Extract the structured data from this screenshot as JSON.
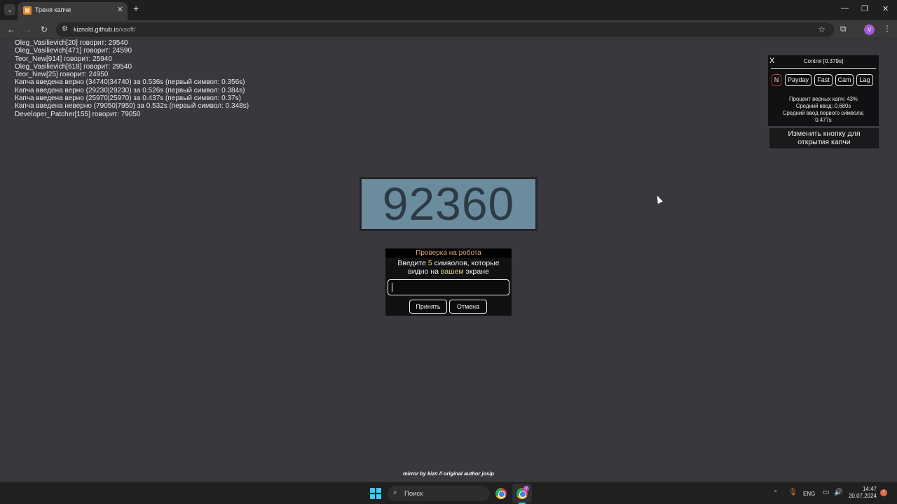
{
  "browser": {
    "tab_title": "Треня капчи",
    "url_host": "kiznold.github.io",
    "url_path": "/xsoft/",
    "icons": {
      "tab_search": "chevron-down-icon",
      "new_tab": "plus-icon",
      "back": "arrow-left-icon",
      "forward": "arrow-right-icon",
      "reload": "reload-icon",
      "bookmark": "star-icon",
      "extensions": "puzzle-icon",
      "menu": "more-vertical-icon"
    },
    "profile_letter": "V",
    "window_controls": {
      "minimize": "—",
      "maximize": "❐",
      "close": "✕"
    }
  },
  "log": [
    "Oleg_Vasilievich[20] говорит: 29540",
    "Oleg_Vasilievich[471] говорит: 24590",
    "Teor_New[914] говорит: 25940",
    "Oleg_Vasilievich[618] говорит: 29540",
    "Teor_New[25] говорит: 24950",
    "Капча введена верно (34740|34740) за 0.536s (первый символ: 0.356s)",
    "Капча введена верно (29230|29230) за 0.526s (первый символ: 0.384s)",
    "Капча введена верно (25970|25970) за 0.437s (первый символ: 0.37s)",
    "Капча введена неверно (79050|7950) за 0.532s (первый символ: 0.348s)",
    "Developer_Patcher[155] говорит: 79050"
  ],
  "captcha": {
    "code": "92360",
    "colors": {
      "background": "#6b8c9c",
      "text": "#2d3a45"
    }
  },
  "dialog": {
    "title": "Проверка на робота",
    "msg_before_num": "Введите ",
    "msg_num": "5",
    "msg_after_num": " символов, которые",
    "msg_line2_before": "видно на ",
    "msg_highlight": "вашем",
    "msg_line2_after": " экране",
    "input_value": "",
    "accept_label": "Принять",
    "cancel_label": "Отмена",
    "colors": {
      "title": "#e3a776",
      "highlight_number": "#ffd76a"
    }
  },
  "control": {
    "close_label": "X",
    "title": "Control [0.379s]",
    "buttons": [
      "N",
      "Payday",
      "Fast",
      "Cam",
      "Lag"
    ],
    "stats": [
      "Процент верных капч: 43%",
      "Средний ввод: 0.680s",
      "Средний ввод первого символа:",
      "0.477s"
    ],
    "change_button_line1": "Изменить кнопку для",
    "change_button_line2": "открытия капчи"
  },
  "footer": "mirror by kizn // original author josip",
  "taskbar": {
    "search_placeholder": "Поиск",
    "lang": "ENG",
    "time": "14:47",
    "date": "20.07.2024",
    "chrome_badge": "V",
    "notification": "!",
    "icons": {
      "start": "windows-logo-icon",
      "search": "search-icon",
      "chrome": "chrome-icon",
      "mic": "microphone-icon",
      "network": "network-icon",
      "volume": "volume-icon"
    }
  }
}
